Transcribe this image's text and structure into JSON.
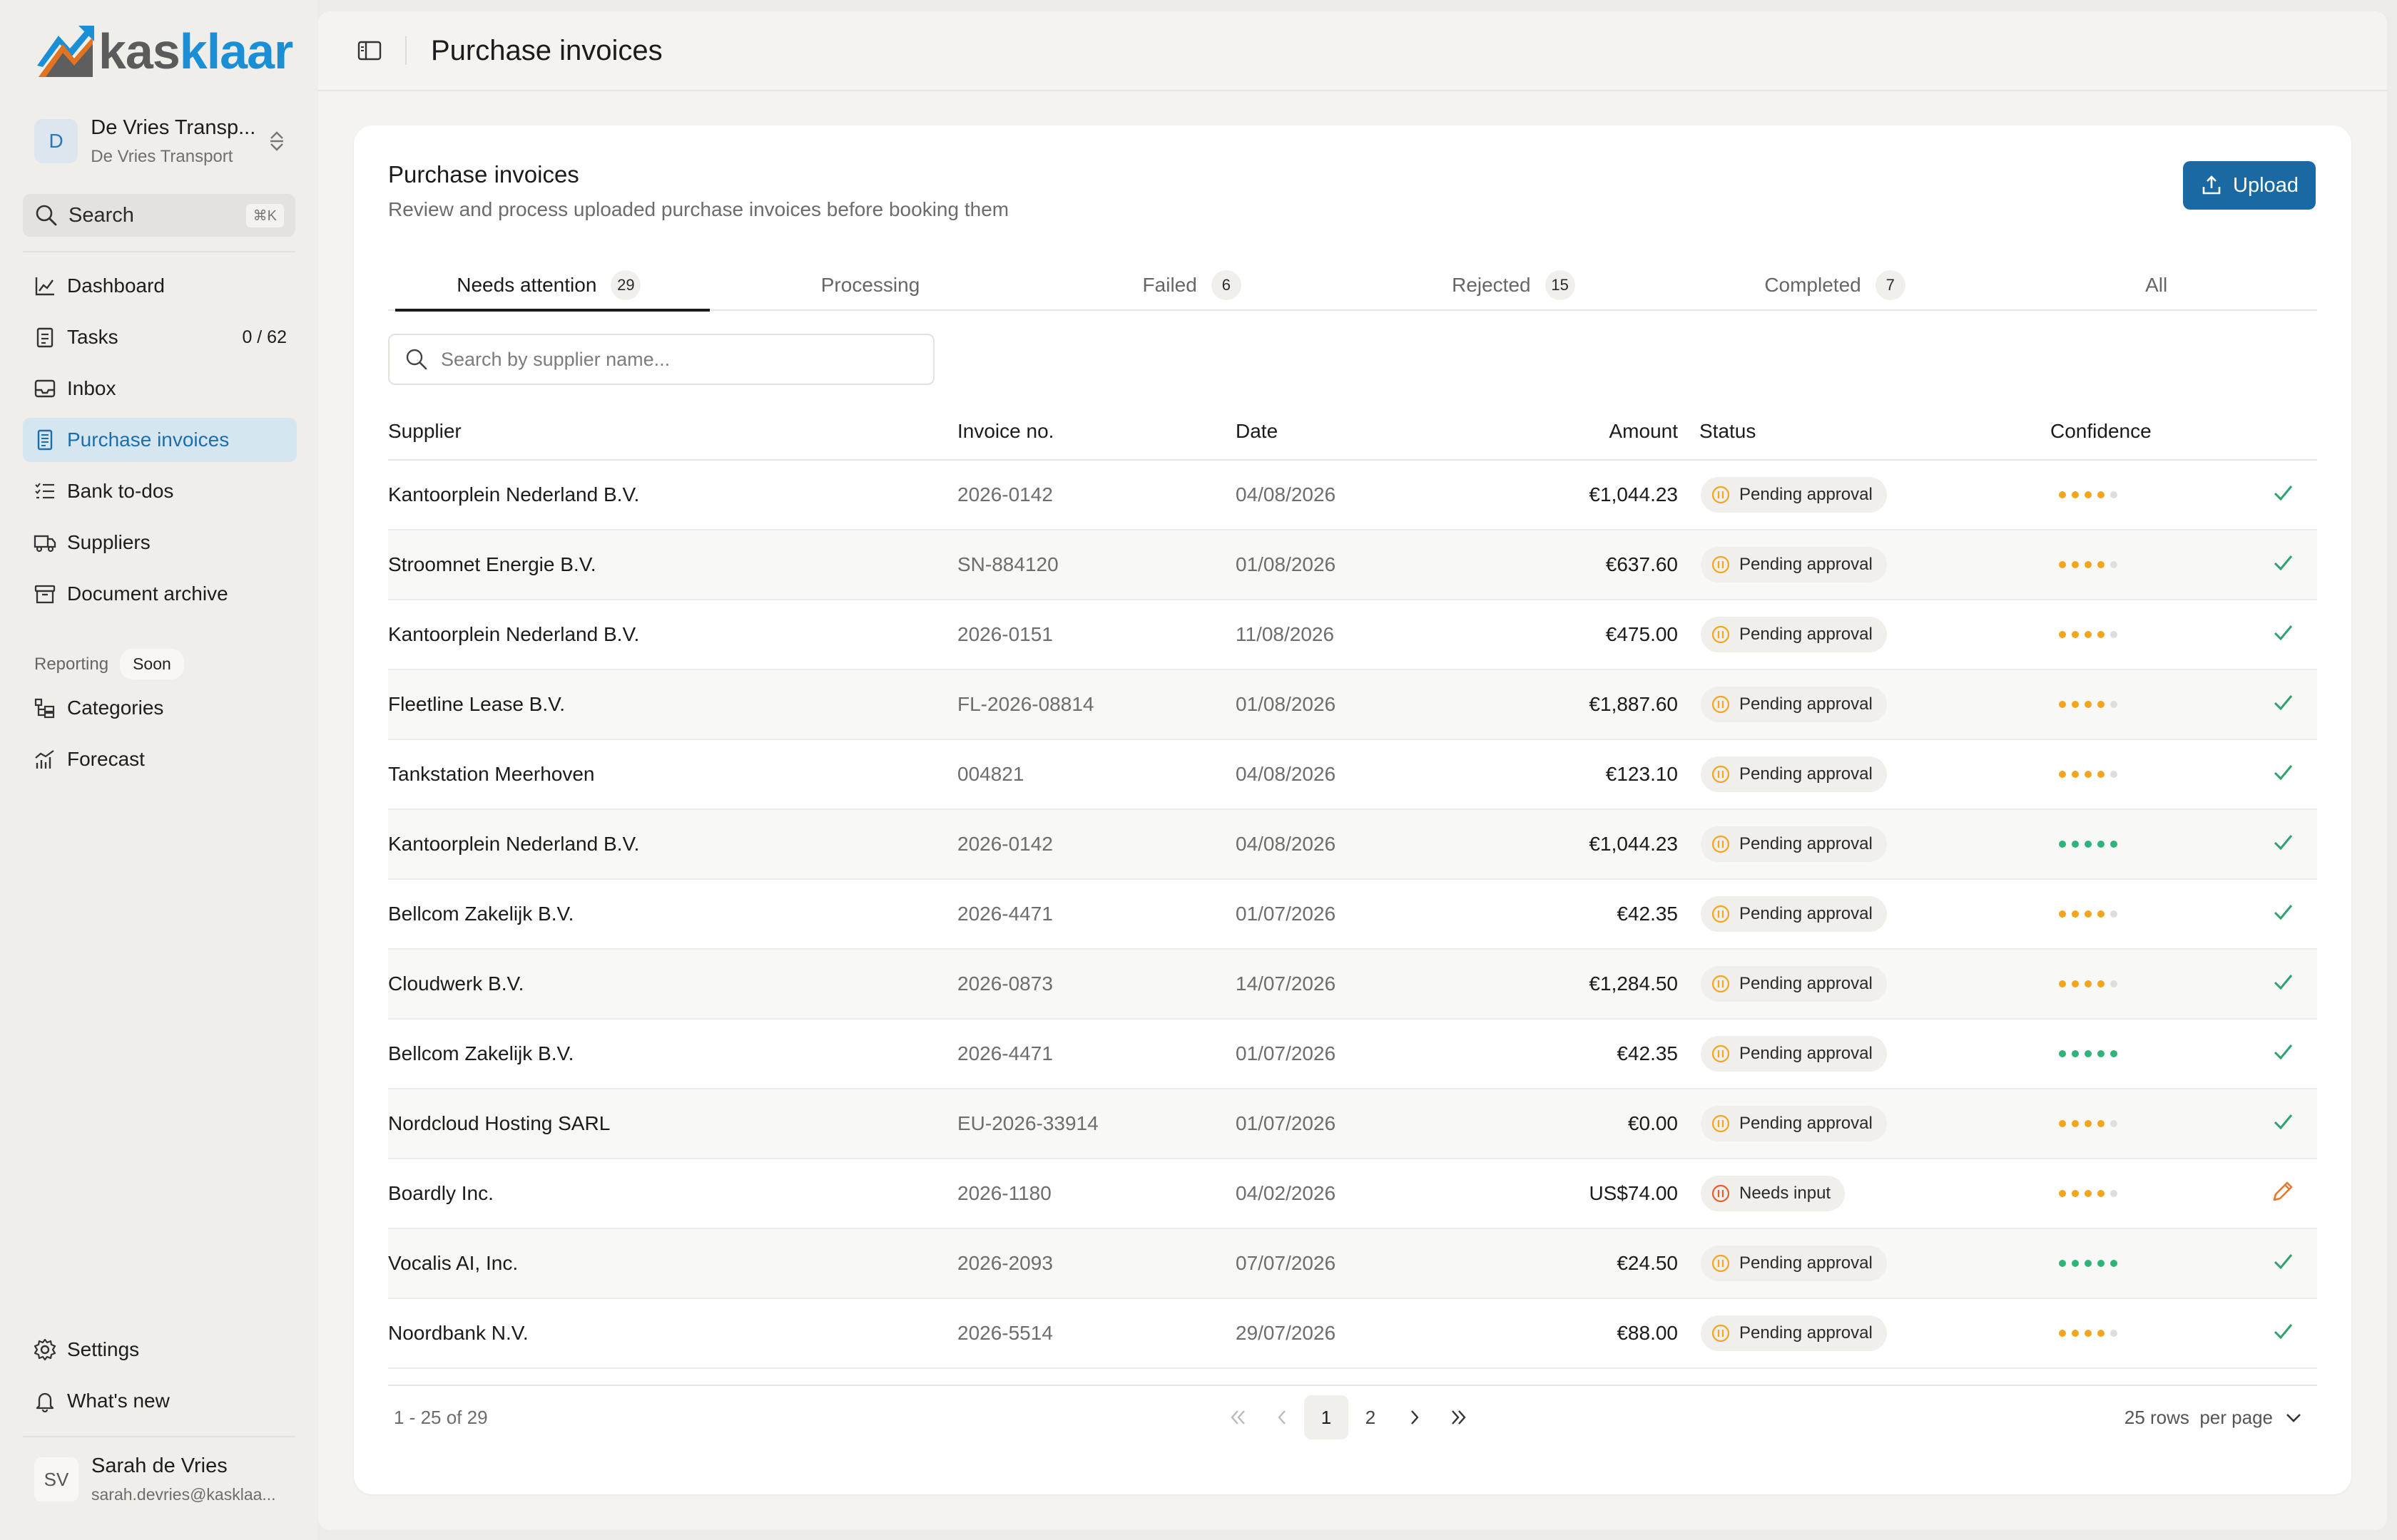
{
  "app": {
    "logo_part1": "kas",
    "logo_part2": "klaar",
    "brand_color": "#1a8fd6"
  },
  "org": {
    "avatar": "D",
    "name": "De Vries Transp...",
    "subtitle": "De Vries Transport"
  },
  "sidebar": {
    "search_label": "Search",
    "search_shortcut": "⌘K",
    "nav": [
      {
        "label": "Dashboard",
        "icon": "chart-icon"
      },
      {
        "label": "Tasks",
        "count": "0 / 62",
        "icon": "checklist-icon"
      },
      {
        "label": "Inbox",
        "icon": "inbox-icon"
      },
      {
        "label": "Purchase invoices",
        "icon": "receipt-icon",
        "active": true
      },
      {
        "label": "Bank to-dos",
        "icon": "list-icon"
      },
      {
        "label": "Suppliers",
        "icon": "truck-icon"
      },
      {
        "label": "Document archive",
        "icon": "archive-icon"
      }
    ],
    "reporting_label": "Reporting",
    "reporting_badge": "Soon",
    "reporting_nav": [
      {
        "label": "Categories",
        "icon": "categories-icon"
      },
      {
        "label": "Forecast",
        "icon": "forecast-icon"
      }
    ],
    "bottom_nav": [
      {
        "label": "Settings",
        "icon": "gear-icon"
      },
      {
        "label": "What's new",
        "icon": "bell-icon"
      }
    ],
    "user": {
      "initials": "SV",
      "name": "Sarah de Vries",
      "email": "sarah.devries@kasklaa..."
    }
  },
  "header": {
    "title": "Purchase invoices"
  },
  "card": {
    "title": "Purchase invoices",
    "subtitle": "Review and process uploaded purchase invoices before booking them",
    "upload_label": "Upload"
  },
  "tabs": [
    {
      "label": "Needs attention",
      "count": "29",
      "active": true
    },
    {
      "label": "Processing",
      "count": ""
    },
    {
      "label": "Failed",
      "count": "6"
    },
    {
      "label": "Rejected",
      "count": "15"
    },
    {
      "label": "Completed",
      "count": "7"
    },
    {
      "label": "All",
      "count": ""
    }
  ],
  "search": {
    "placeholder": "Search by supplier name..."
  },
  "table": {
    "columns": {
      "supplier": "Supplier",
      "invoice": "Invoice no.",
      "date": "Date",
      "amount": "Amount",
      "status": "Status",
      "confidence": "Confidence"
    },
    "rows": [
      {
        "supplier": "Kantoorplein Nederland B.V.",
        "invoice": "2026-0142",
        "date": "04/08/2026",
        "amount": "€1,044.23",
        "status": "Pending approval",
        "conf": "oooo-",
        "action": "check"
      },
      {
        "supplier": "Stroomnet Energie B.V.",
        "invoice": "SN-884120",
        "date": "01/08/2026",
        "amount": "€637.60",
        "status": "Pending approval",
        "conf": "oooo-",
        "action": "check"
      },
      {
        "supplier": "Kantoorplein Nederland B.V.",
        "invoice": "2026-0151",
        "date": "11/08/2026",
        "amount": "€475.00",
        "status": "Pending approval",
        "conf": "oooo-",
        "action": "check"
      },
      {
        "supplier": "Fleetline Lease B.V.",
        "invoice": "FL-2026-08814",
        "date": "01/08/2026",
        "amount": "€1,887.60",
        "status": "Pending approval",
        "conf": "oooo-",
        "action": "check"
      },
      {
        "supplier": "Tankstation Meerhoven",
        "invoice": "004821",
        "date": "04/08/2026",
        "amount": "€123.10",
        "status": "Pending approval",
        "conf": "oooo-",
        "action": "check"
      },
      {
        "supplier": "Kantoorplein Nederland B.V.",
        "invoice": "2026-0142",
        "date": "04/08/2026",
        "amount": "€1,044.23",
        "status": "Pending approval",
        "conf": "ggggg",
        "action": "check"
      },
      {
        "supplier": "Bellcom Zakelijk B.V.",
        "invoice": "2026-4471",
        "date": "01/07/2026",
        "amount": "€42.35",
        "status": "Pending approval",
        "conf": "oooo-",
        "action": "check"
      },
      {
        "supplier": "Cloudwerk B.V.",
        "invoice": "2026-0873",
        "date": "14/07/2026",
        "amount": "€1,284.50",
        "status": "Pending approval",
        "conf": "oooo-",
        "action": "check"
      },
      {
        "supplier": "Bellcom Zakelijk B.V.",
        "invoice": "2026-4471",
        "date": "01/07/2026",
        "amount": "€42.35",
        "status": "Pending approval",
        "conf": "ggggg",
        "action": "check"
      },
      {
        "supplier": "Nordcloud Hosting SARL",
        "invoice": "EU-2026-33914",
        "date": "01/07/2026",
        "amount": "€0.00",
        "status": "Pending approval",
        "conf": "oooo-",
        "action": "check"
      },
      {
        "supplier": "Boardly Inc.",
        "invoice": "2026-1180",
        "date": "04/02/2026",
        "amount": "US$74.00",
        "status": "Needs input",
        "conf": "oooo-",
        "action": "edit"
      },
      {
        "supplier": "Vocalis AI, Inc.",
        "invoice": "2026-2093",
        "date": "07/07/2026",
        "amount": "€24.50",
        "status": "Pending approval",
        "conf": "ggggg",
        "action": "check"
      },
      {
        "supplier": "Noordbank N.V.",
        "invoice": "2026-5514",
        "date": "29/07/2026",
        "amount": "€88.00",
        "status": "Pending approval",
        "conf": "oooo-",
        "action": "check"
      }
    ]
  },
  "pagination": {
    "range": "1 - 25 of 29",
    "pages": [
      "1",
      "2"
    ],
    "current": "1",
    "rows_per_page": "25 rows  per page"
  },
  "colors": {
    "pending": "#f2a51d",
    "needs_input": "#e0622a",
    "check": "#2fa36e",
    "edit": "#e7782d"
  }
}
